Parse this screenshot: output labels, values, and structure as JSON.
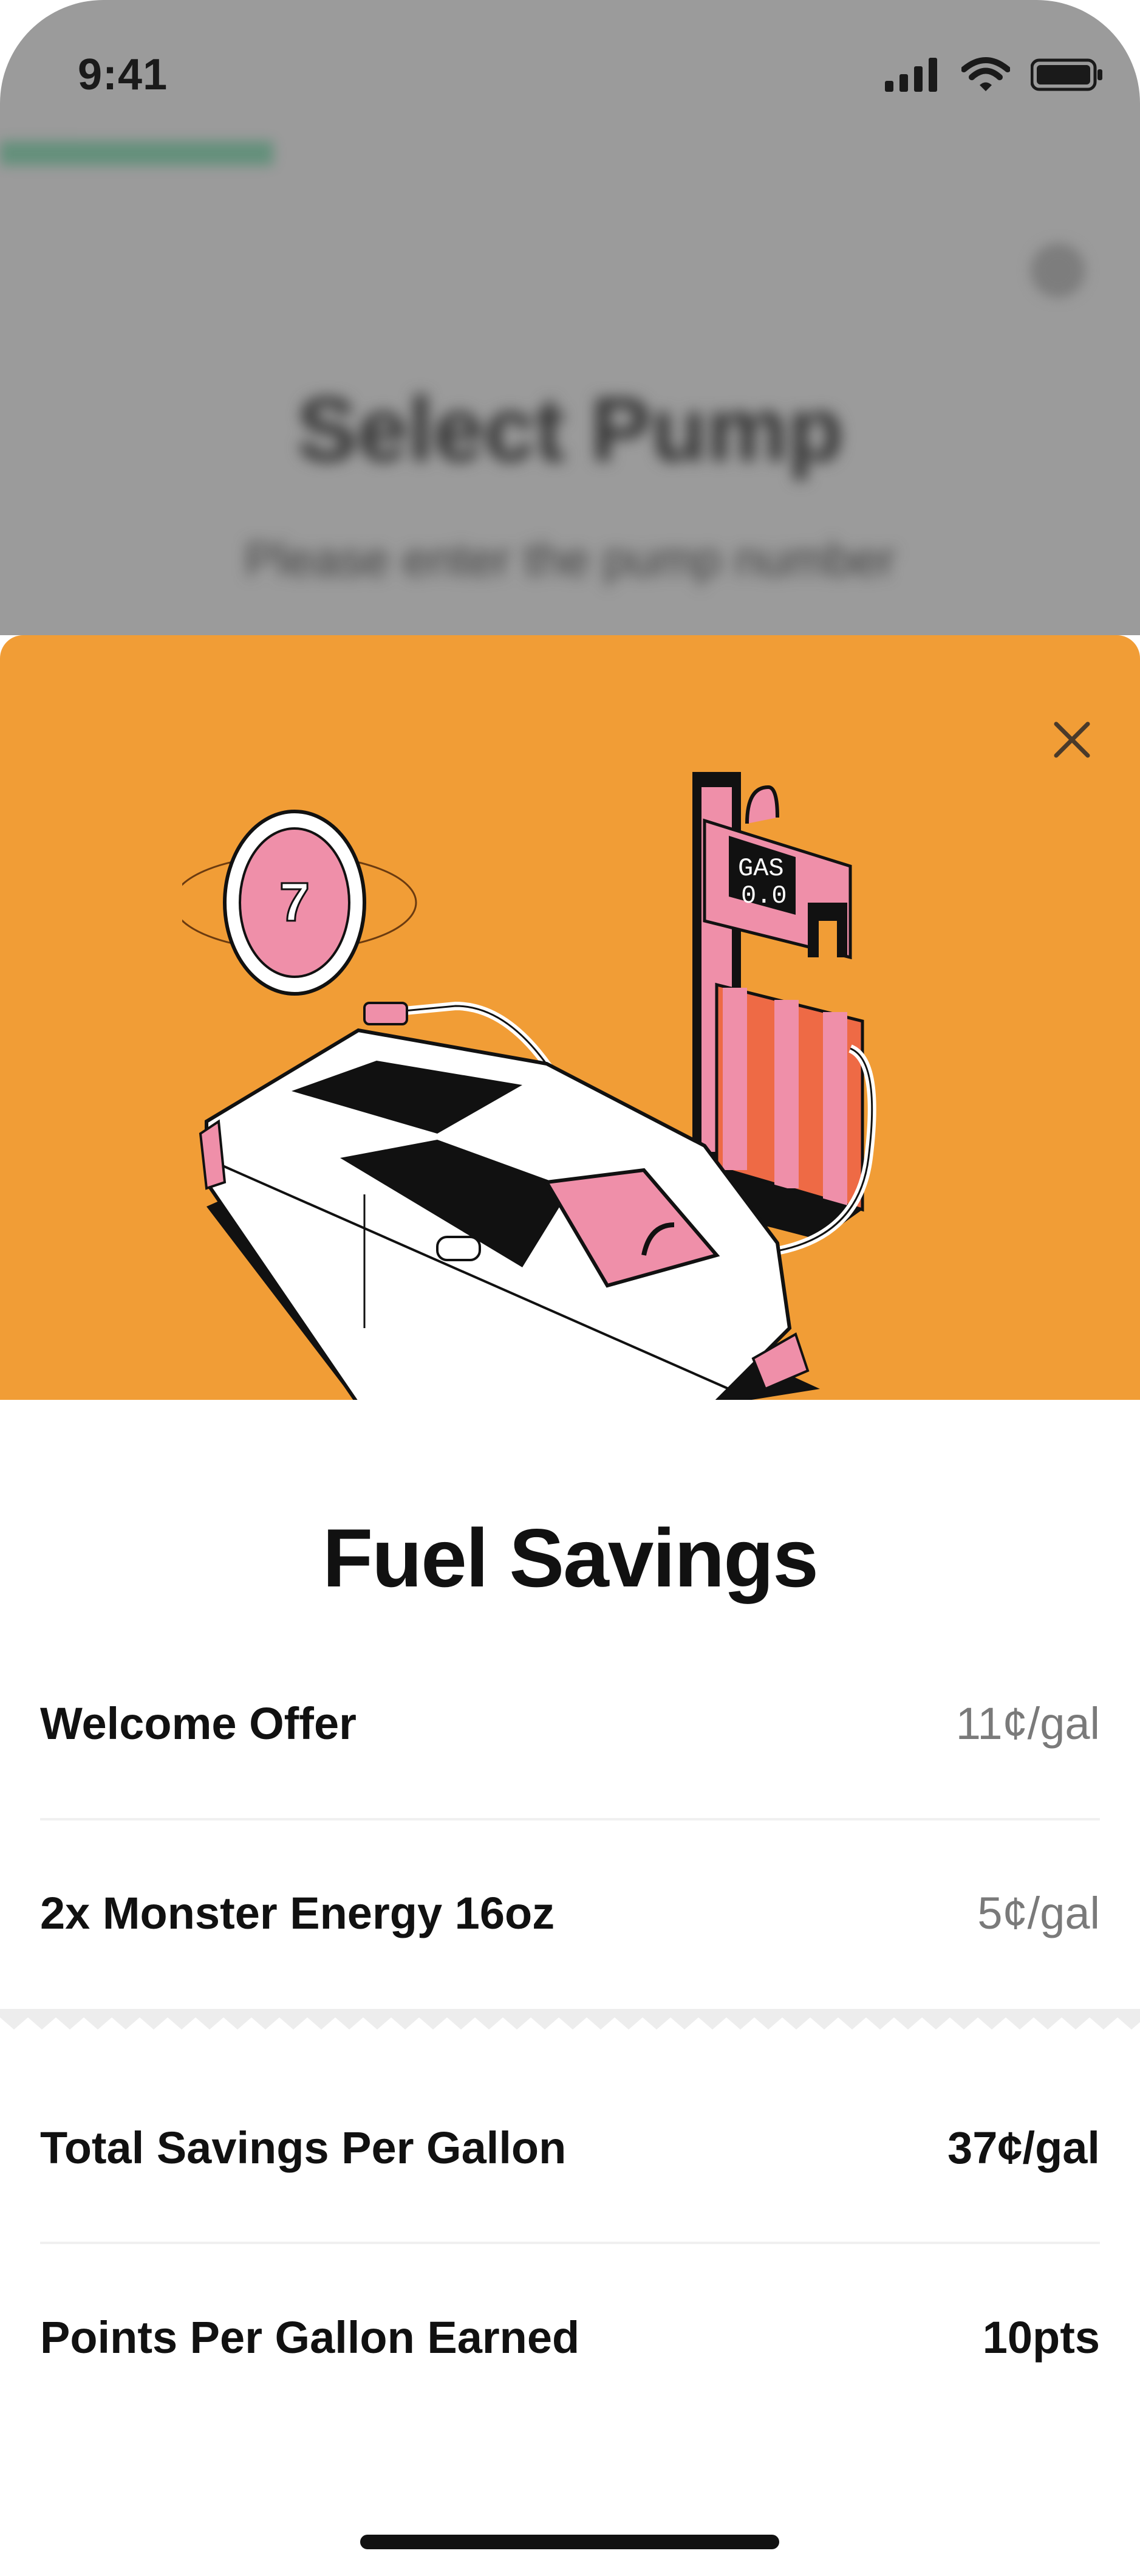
{
  "status_bar": {
    "time": "9:41"
  },
  "background_screen": {
    "title": "Select Pump",
    "subtitle": "Please enter the pump number"
  },
  "illustration": {
    "pump_display": "GAS 0.0",
    "coin_label": "7"
  },
  "modal": {
    "title": "Fuel Savings",
    "offers": [
      {
        "label": "Welcome Offer",
        "value": "11¢/gal"
      },
      {
        "label": "2x Monster Energy 16oz",
        "value": "5¢/gal"
      }
    ],
    "summary": [
      {
        "label": "Total Savings Per Gallon",
        "value": "37¢/gal"
      },
      {
        "label": "Points Per Gallon Earned",
        "value": "10pts"
      }
    ]
  },
  "colors": {
    "hero_background": "#f19d36",
    "accent_pink": "#ef8fa9",
    "pump_red": "#ee6a45",
    "progress_green": "#5e8f78"
  },
  "icons": [
    "signal-icon",
    "wifi-icon",
    "battery-icon",
    "close-icon",
    "settings-icon"
  ]
}
